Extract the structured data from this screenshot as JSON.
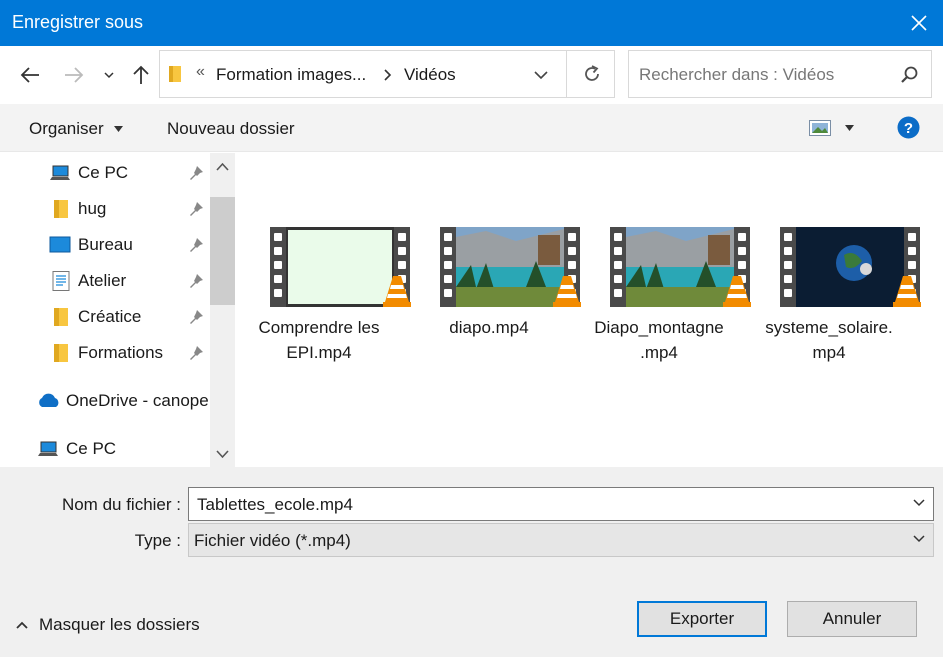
{
  "window": {
    "title": "Enregistrer sous"
  },
  "address": {
    "crumbs": [
      "Formation images...",
      "Vidéos"
    ],
    "overflow": "«"
  },
  "search": {
    "placeholder": "Rechercher dans : Vidéos"
  },
  "toolbar": {
    "organiser": "Organiser",
    "new_folder": "Nouveau dossier"
  },
  "sidebar": {
    "items": [
      {
        "label": "Ce PC",
        "icon": "computer-icon",
        "pinned": true
      },
      {
        "label": "hug",
        "icon": "folder-icon",
        "pinned": true
      },
      {
        "label": "Bureau",
        "icon": "desktop-icon",
        "pinned": true
      },
      {
        "label": "Atelier",
        "icon": "document-icon",
        "pinned": true
      },
      {
        "label": "Créatice",
        "icon": "folder-icon",
        "pinned": true
      },
      {
        "label": "Formations",
        "icon": "folder-icon",
        "pinned": true
      },
      {
        "label": "OneDrive - canope",
        "icon": "cloud-icon",
        "pinned": false
      },
      {
        "label": "Ce PC",
        "icon": "computer-icon",
        "pinned": false
      }
    ]
  },
  "files": [
    {
      "name_line1": "Comprendre les",
      "name_line2": "EPI.mp4",
      "thumb": "blank"
    },
    {
      "name_line1": "diapo.mp4",
      "name_line2": "",
      "thumb": "lake"
    },
    {
      "name_line1": "Diapo_montagne",
      "name_line2": ".mp4",
      "thumb": "lake"
    },
    {
      "name_line1": "systeme_solaire.",
      "name_line2": "mp4",
      "thumb": "space"
    }
  ],
  "form": {
    "filename_label": "Nom du fichier :",
    "filename_value": "Tablettes_ecole.mp4",
    "type_label": "Type :",
    "type_value": "Fichier vidéo (*.mp4)"
  },
  "footer": {
    "hide_folders": "Masquer les dossiers",
    "export": "Exporter",
    "cancel": "Annuler"
  },
  "colors": {
    "accent": "#0078d7",
    "titlebar": "#0078d7",
    "folder": "#f8c640"
  }
}
